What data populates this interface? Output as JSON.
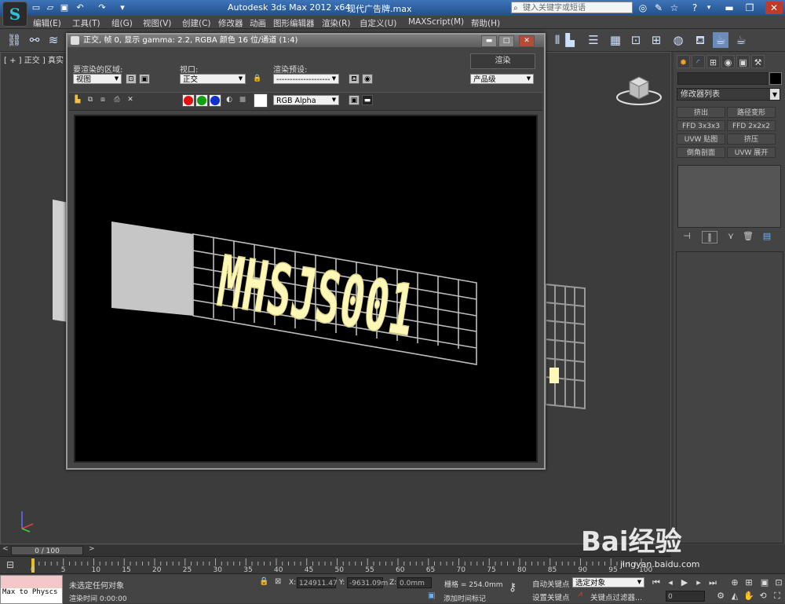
{
  "app": {
    "title": "Autodesk 3ds Max  2012 x64",
    "file": "现代广告牌.max",
    "search_placeholder": "键入关键字或短语",
    "logo_letter": "S"
  },
  "menu": [
    "编辑(E)",
    "工具(T)",
    "组(G)",
    "视图(V)",
    "创建(C)",
    "修改器",
    "动画",
    "图形编辑器",
    "渲染(R)",
    "自定义(U)",
    "MAXScript(M)",
    "帮助(H)"
  ],
  "viewport": {
    "label": "[ + ] 正交 ] 真实",
    "scene_text": "MHSJS001"
  },
  "render_window": {
    "title": "正交, 帧 0, 显示 gamma: 2.2, RGBA 颜色 16 位/通道 (1:4)",
    "area_label": "要渲染的区域:",
    "area_value": "视图",
    "viewport_label": "视口:",
    "viewport_value": "正交",
    "preset_label": "渲染预设:",
    "preset_value": "--------------------",
    "render_button": "渲染",
    "quality_value": "产品级",
    "channel_value": "RGB Alpha",
    "win_min": "▬",
    "win_max": "□",
    "win_close": "✕"
  },
  "command_panel": {
    "modifier_list": "修改器列表",
    "buttons": [
      "挤出",
      "路径变形",
      "FFD 3x3x3",
      "FFD 2x2x2",
      "UVW 贴图",
      "挤压",
      "倒角剖面",
      "UVW 展开"
    ]
  },
  "timeline": {
    "range": "0 / 100",
    "ticks": [
      "0",
      "5",
      "10",
      "15",
      "20",
      "25",
      "30",
      "35",
      "40",
      "45",
      "50",
      "55",
      "60",
      "65",
      "70",
      "75",
      "80",
      "85",
      "90",
      "95",
      "100"
    ]
  },
  "status": {
    "maxscript": "Max to Physcs (",
    "selection": "未选定任何对象",
    "render_time": "渲染时间  0:00:00",
    "x_label": "X:",
    "x_value": "124911.47",
    "y_label": "Y:",
    "y_value": "-9631.09m",
    "z_label": "Z:",
    "z_value": "0.0mm",
    "grid": "栅格 = 254.0mm",
    "add_time_tag": "添加时间标记",
    "auto_key": "自动关键点",
    "auto_key_value": "选定对象",
    "set_key": "设置关键点",
    "key_filter": "关键点过滤器...",
    "frame": "0"
  },
  "watermark": {
    "brand": "Bai经验",
    "url": "jingyan.baidu.com"
  },
  "colors": {
    "titlebar": "#2f62a8",
    "scene_text": "#fdf7b8",
    "grid_lines": "#bdbdbd",
    "panel_white": "#c6c6c6"
  }
}
